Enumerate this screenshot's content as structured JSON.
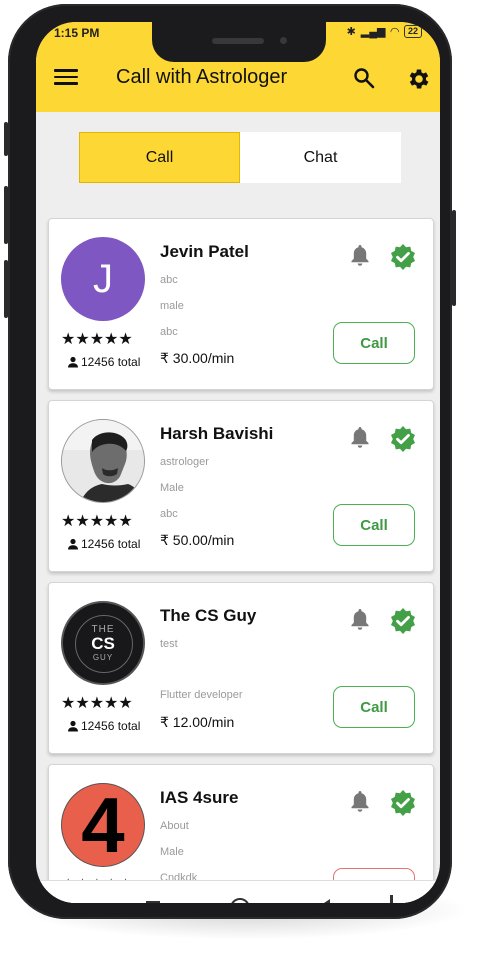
{
  "status": {
    "time": "1:15 PM",
    "battery": "22"
  },
  "appbar": {
    "title": "Call with Astrologer"
  },
  "tabs": [
    {
      "label": "Call",
      "active": true
    },
    {
      "label": "Chat",
      "active": false
    }
  ],
  "astrologers": [
    {
      "name": "Jevin Patel",
      "lines": [
        "abc",
        "male",
        "abc"
      ],
      "price": "₹ 30.00/min",
      "stars": "★★★★★",
      "total": "12456 total",
      "avatar_letter": "J",
      "call_label": "Call"
    },
    {
      "name": "Harsh Bavishi",
      "lines": [
        "astrologer",
        "Male",
        "abc"
      ],
      "price": "₹ 50.00/min",
      "stars": "★★★★★",
      "total": "12456 total",
      "call_label": "Call"
    },
    {
      "name": "The CS Guy",
      "lines": [
        "test",
        "Flutter developer"
      ],
      "price": "₹ 12.00/min",
      "stars": "★★★★★",
      "total": "12456 total",
      "avatar_text": [
        "THE",
        "CS",
        "GUY"
      ],
      "call_label": "Call"
    },
    {
      "name": "IAS 4sure",
      "lines": [
        "About",
        "Male",
        "Cndkdk"
      ],
      "stars": "★★★★★",
      "avatar_text": "4"
    }
  ],
  "colors": {
    "accent": "#fdd835",
    "verified": "#43a047",
    "call_border": "#4caf50",
    "avatar_purple": "#7e57c2"
  }
}
